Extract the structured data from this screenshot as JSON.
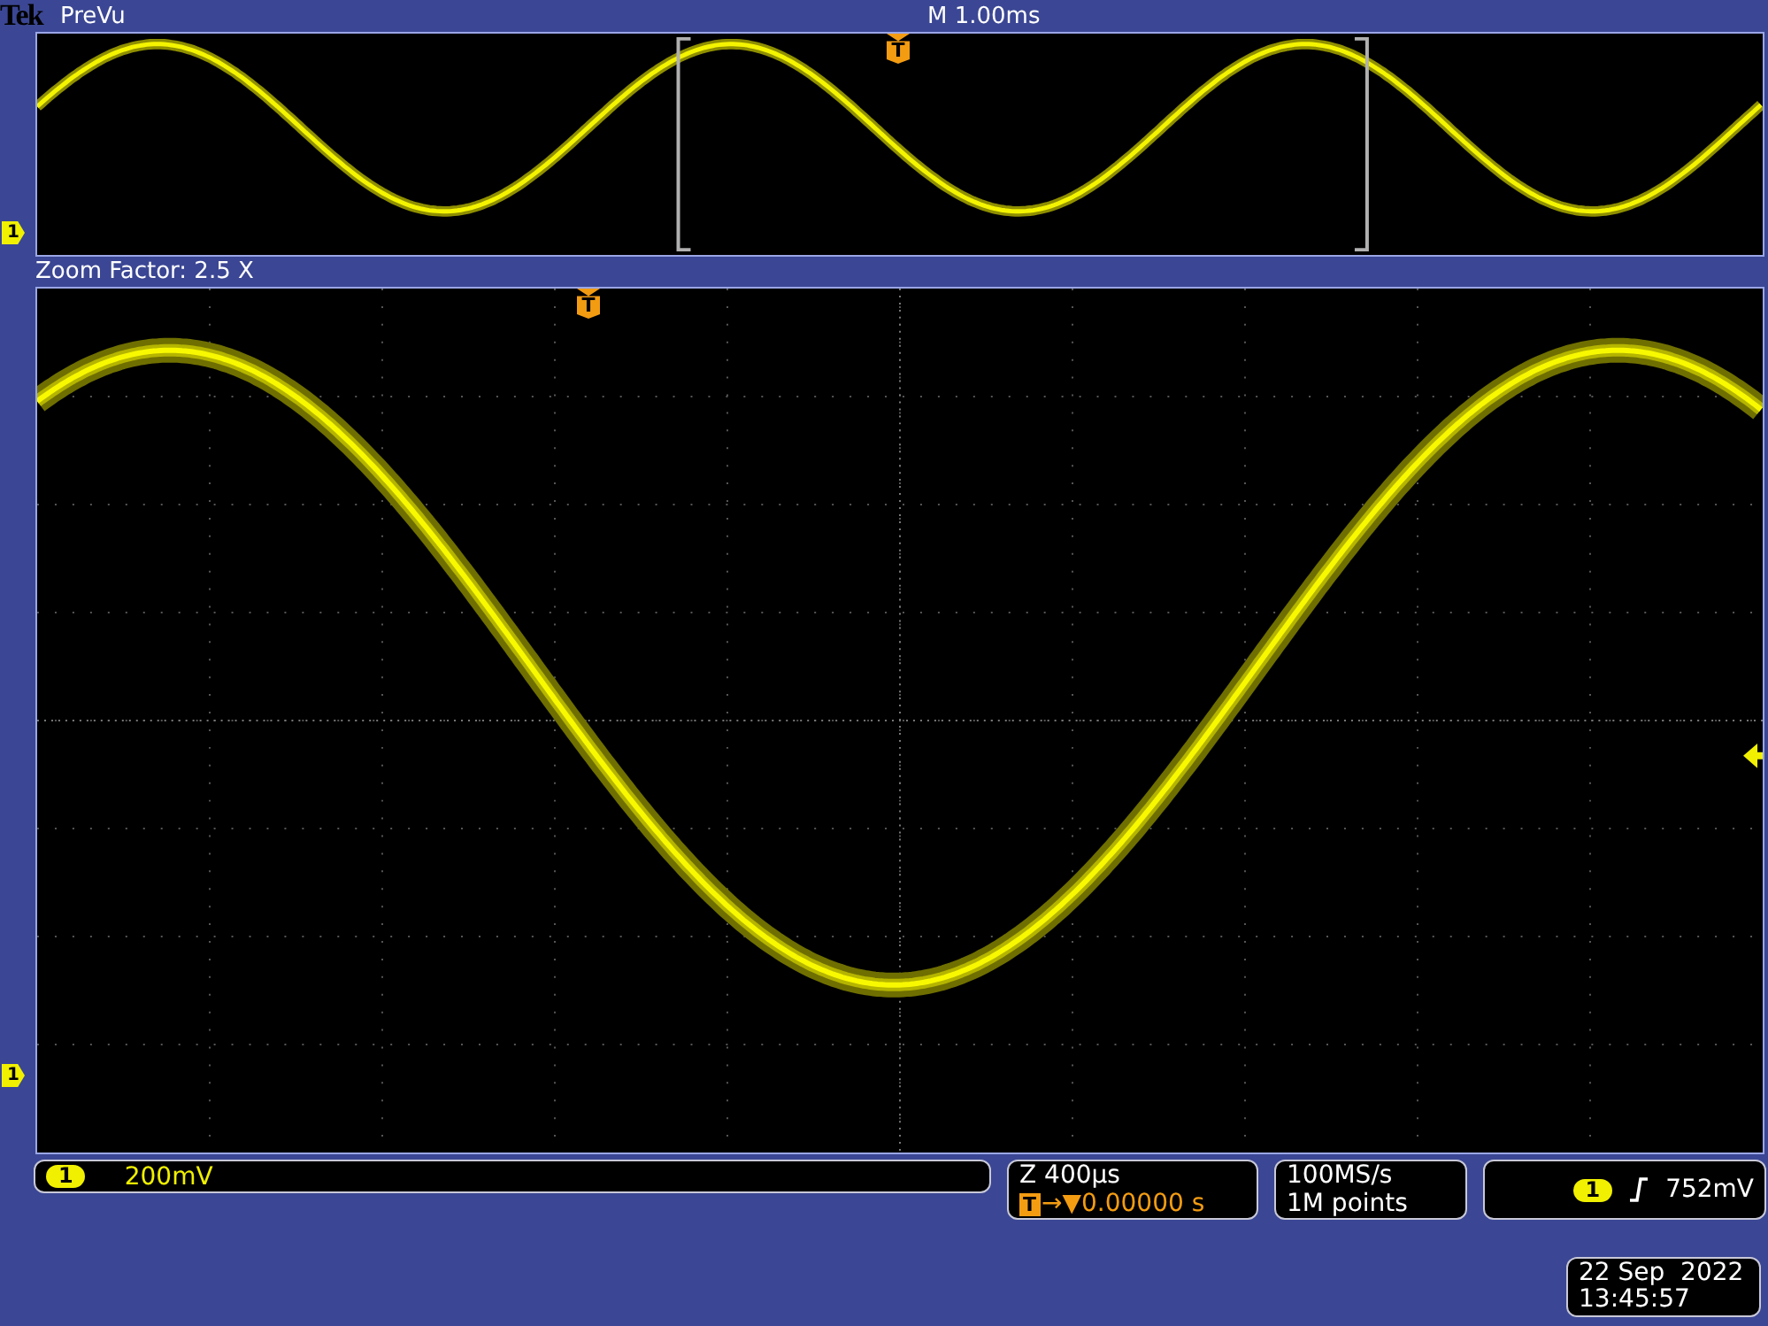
{
  "header": {
    "brand": "Tek",
    "mode": "PreVu",
    "timebase": "M 1.00ms"
  },
  "overview": {
    "trigger_marker": "T",
    "ground_marker": "1"
  },
  "zoom_bar": {
    "label": "Zoom Factor: 2.5 X"
  },
  "main": {
    "trigger_marker": "T",
    "ground_marker": "1"
  },
  "readouts": {
    "channel": {
      "badge": "1",
      "scale": "200mV"
    },
    "zoom": {
      "timebase": "Z 400µs",
      "marker": "T",
      "arrow": "→▼",
      "position": "0.00000 s"
    },
    "acquisition": {
      "rate": "100MS/s",
      "length": "1M points"
    },
    "trigger": {
      "badge": "1",
      "level": "752mV"
    }
  },
  "clock": {
    "date": "22 Sep  2022",
    "time": "13:45:57"
  }
}
